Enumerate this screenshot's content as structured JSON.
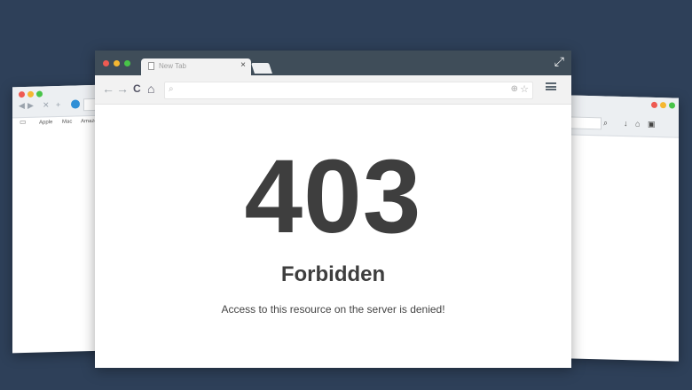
{
  "left_browser": {
    "bookmarks": [
      "Apple",
      "Mac",
      "Amazo"
    ]
  },
  "main_browser": {
    "tab": {
      "title": "New Tab",
      "close_glyph": "×"
    },
    "toolbar": {
      "back_glyph": "←",
      "forward_glyph": "→",
      "reload_glyph": "C",
      "home_glyph": "⌂",
      "search_icon": "⌕",
      "zoom_icon": "⊕",
      "star_icon": "☆"
    },
    "expand_glyph": "⤢"
  },
  "page": {
    "error_code": "403",
    "error_title": "Forbidden",
    "error_message": "Access to this resource on the server is denied!"
  },
  "colors": {
    "background": "#2e4059",
    "titlebar": "#3f4d59",
    "text": "#3e3e3e"
  }
}
